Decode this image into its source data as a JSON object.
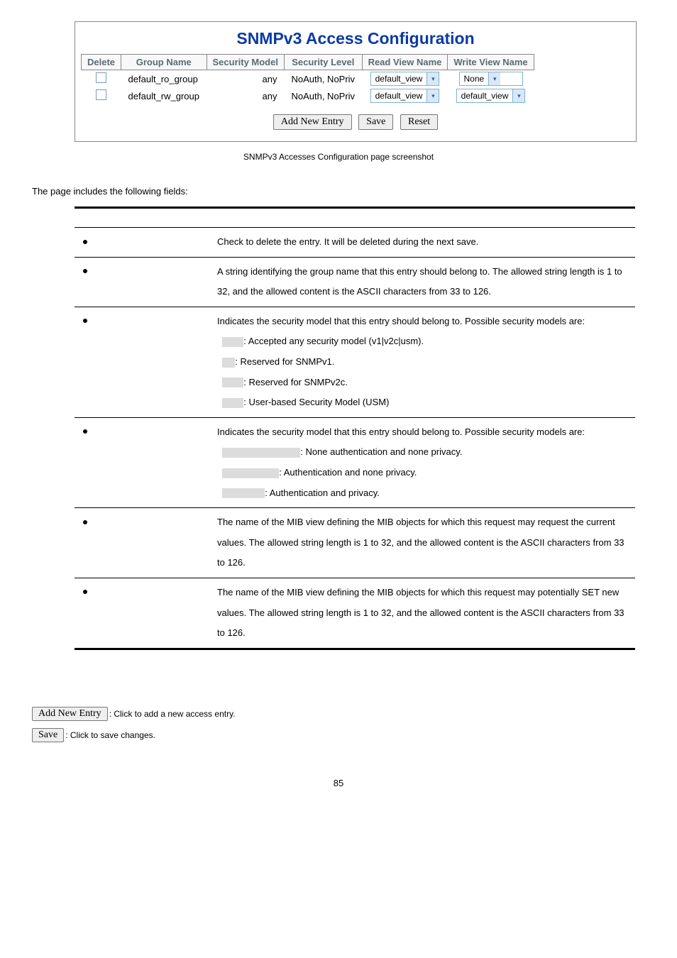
{
  "figure": {
    "title": "SNMPv3 Access Configuration",
    "headers": [
      "Delete",
      "Group Name",
      "Security Model",
      "Security Level",
      "Read View Name",
      "Write View Name"
    ],
    "rows": [
      {
        "group": "default_ro_group",
        "model": "any",
        "level": "NoAuth, NoPriv",
        "read": "default_view",
        "write": "None"
      },
      {
        "group": "default_rw_group",
        "model": "any",
        "level": "NoAuth, NoPriv",
        "read": "default_view",
        "write": "default_view"
      }
    ],
    "buttons": {
      "add": "Add New Entry",
      "save": "Save",
      "reset": "Reset"
    },
    "caption": "SNMPv3 Accesses Configuration page screenshot"
  },
  "intro": "The page includes the following fields:",
  "fields": [
    {
      "desc": "Check to delete the entry. It will be deleted during the next save."
    },
    {
      "desc": "A string identifying the group name that this entry should belong to. The allowed string length is 1 to 32, and the allowed content is the ASCII characters from 33 to 126."
    },
    {
      "desc_head": "Indicates the security model that this entry should belong to. Possible security models are:",
      "items": [
        {
          "tail": ": Accepted any security model (v1|v2c|usm)."
        },
        {
          "tail": ": Reserved for SNMPv1."
        },
        {
          "tail": ": Reserved for SNMPv2c."
        },
        {
          "tail": ": User-based Security Model (USM)"
        }
      ]
    },
    {
      "desc_head": "Indicates the security model that this entry should belong to. Possible security models are:",
      "items": [
        {
          "tail": ": None authentication and none privacy."
        },
        {
          "tail": ": Authentication and none privacy."
        },
        {
          "tail": ": Authentication and privacy."
        }
      ]
    },
    {
      "desc": "The name of the MIB view defining the MIB objects for which this request may request the current values. The allowed string length is 1 to 32, and the allowed content is the ASCII characters from 33 to 126."
    },
    {
      "desc": "The name of the MIB view defining the MIB objects for which this request may potentially SET new values. The allowed string length is 1 to 32, and the allowed content is the ASCII characters from 33 to 126."
    }
  ],
  "footer": {
    "add": {
      "btn": "Add New Entry",
      "txt": ": Click to add a new access entry."
    },
    "save": {
      "btn": "Save",
      "txt": ": Click to save changes."
    }
  },
  "page": "85"
}
